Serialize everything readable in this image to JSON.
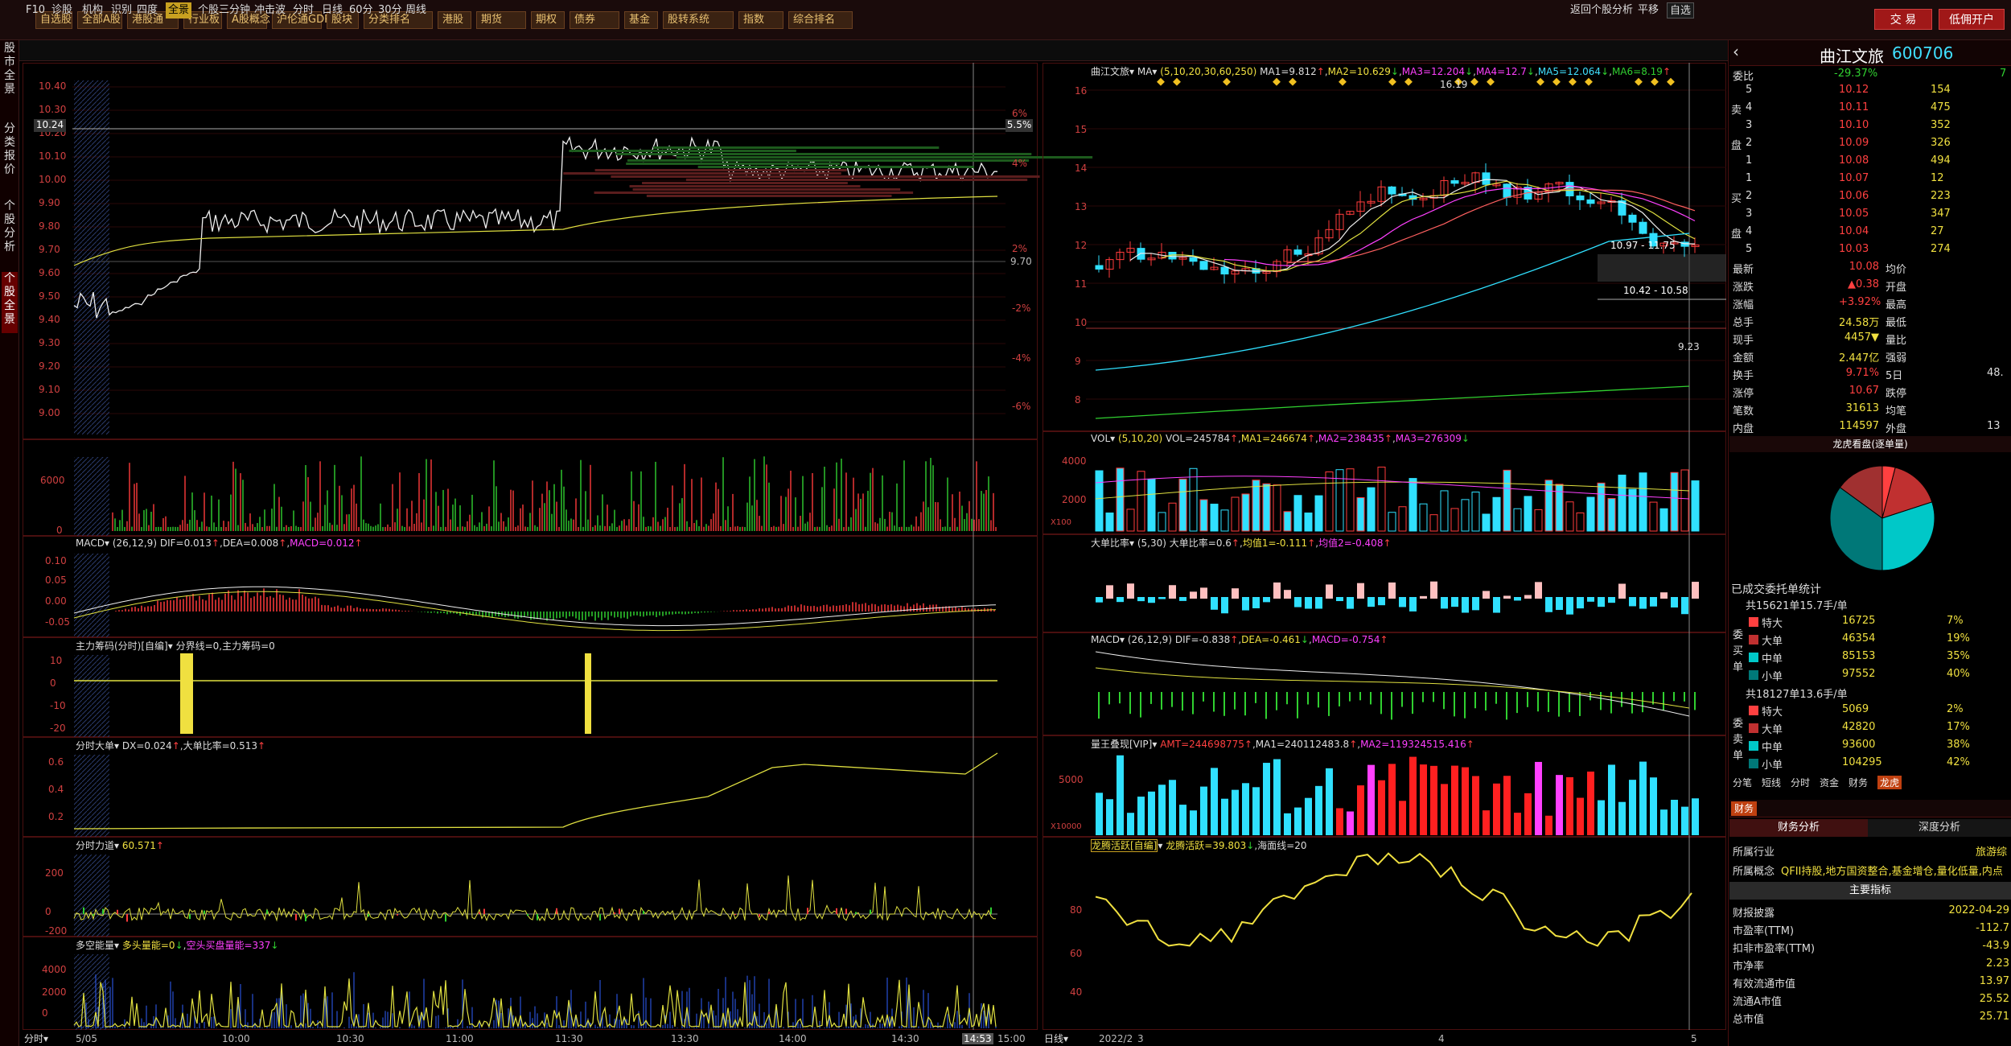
{
  "topbar": {
    "items": [
      "自选股",
      "全部A股",
      "港股通",
      "行业板",
      "A股概念",
      "沪伦通GDR",
      "股块",
      "分类排名",
      "港股",
      "期货",
      "期权",
      "债券",
      "基金",
      "股转系统",
      "指数",
      "综合排名"
    ],
    "trade": "交 易",
    "open_account": "低佣开户"
  },
  "tabs": {
    "items": [
      "F10",
      "诊股",
      "机构",
      "识别",
      "四度",
      "全景",
      "个股三分钟",
      "冲击波"
    ],
    "active": "全景",
    "chart_tabs": [
      "分时",
      "日线",
      "60分",
      "30分",
      "周线"
    ],
    "right_tabs": [
      "返回个股分析",
      "平移",
      "自选"
    ]
  },
  "rail": [
    "股市全景",
    "分类报价",
    "个股分析",
    "个股全景"
  ],
  "intraday": {
    "price_axis": [
      "10.40",
      "10.30",
      "10.20",
      "10.10",
      "10.00",
      "9.90",
      "9.80",
      "9.70",
      "9.60",
      "9.50",
      "9.40",
      "9.30",
      "9.20",
      "9.10",
      "9.00"
    ],
    "pct_axis": [
      "6%",
      "4%",
      "2%",
      "9.70",
      "-2%",
      "-4%",
      "-6%"
    ],
    "price_tag": "10.24",
    "pct_tag": "5.5%",
    "vol_axis": [
      "6000",
      "0"
    ],
    "macd": {
      "title": "MACD",
      "params": "(26,12,9)",
      "dif": "DIF=0.013",
      "dea": "DEA=0.008",
      "macd": "MACD=0.012",
      "axis": [
        "0.10",
        "0.05",
        "0.00",
        "-0.05"
      ]
    },
    "zhuli": {
      "title": "主力筹码(分时)[自编]",
      "line": "分界线=0,主力筹码=0",
      "axis": [
        "10",
        "0",
        "-10",
        "-20"
      ]
    },
    "dadan": {
      "title": "分时大单",
      "dx": "DX=0.024",
      "ratio": "大单比率=0.513",
      "axis": [
        "0.6",
        "0.4",
        "0.2"
      ]
    },
    "lidao": {
      "title": "分时力道",
      "val": "60.571",
      "axis": [
        "200",
        "0",
        "-200"
      ]
    },
    "duokong": {
      "title": "多空能量",
      "duo": "多头量能=0",
      "kong": "空头买盘量能=337",
      "axis": [
        "4000",
        "2000",
        "0"
      ]
    },
    "time_axis": [
      "5/05",
      "10:00",
      "10:30",
      "11:00",
      "11:30",
      "13:30",
      "14:00",
      "14:30",
      "14:53",
      "15:00"
    ],
    "bottom_label": "分时"
  },
  "daily": {
    "title": "曲江文旅",
    "ma_label": "MA",
    "ma_params": "(5,10,20,30,60,250)",
    "ma": [
      "MA1=9.812",
      "MA2=10.629",
      "MA3=12.204",
      "MA4=12.7",
      "MA5=12.064",
      "MA6=8.19"
    ],
    "price_axis": [
      "16",
      "15",
      "14",
      "13",
      "12",
      "11",
      "10",
      "9",
      "8"
    ],
    "high": "16.19",
    "low": "9.23",
    "box1": "10.97 - 11.75",
    "box2": "10.42 - 10.58",
    "vol": {
      "title": "VOL",
      "params": "(5,10,20)",
      "vals": [
        "VOL=245784",
        "MA1=246674",
        "MA2=238435",
        "MA3=276309"
      ],
      "axis": [
        "4000",
        "2000"
      ],
      "unit": "X100"
    },
    "dadan_ratio": {
      "title": "大单比率",
      "params": "(5,30)",
      "vals": [
        "大单比率=0.6",
        "均值1=-0.111",
        "均值2=-0.408"
      ]
    },
    "macd": {
      "title": "MACD",
      "params": "(26,12,9)",
      "vals": [
        "DIF=-0.838",
        "DEA=-0.461",
        "MACD=-0.754"
      ]
    },
    "liangwang": {
      "title": "量王叠现[VIP]",
      "vals": [
        "AMT=244698775",
        "MA1=240112483.8",
        "MA2=119324515.416"
      ],
      "axis": [
        "5000"
      ],
      "unit": "X10000"
    },
    "longteng": {
      "title": "龙腾活跃[自编]",
      "vals": [
        "龙腾活跃=39.803",
        "海面线=20"
      ],
      "axis": [
        "80",
        "60",
        "40"
      ]
    },
    "time_axis": [
      "2022/2",
      "3",
      "4",
      "5"
    ],
    "bottom_label": "日线"
  },
  "quote": {
    "name": "曲江文旅",
    "code": "600706",
    "weibi": {
      "label": "委比",
      "val": "-29.37%",
      "extra": "7"
    },
    "sells": [
      [
        "5",
        "10.12",
        "154"
      ],
      [
        "4",
        "10.11",
        "475"
      ],
      [
        "3",
        "10.10",
        "352"
      ],
      [
        "2",
        "10.09",
        "326"
      ],
      [
        "1",
        "10.08",
        "494"
      ]
    ],
    "buys": [
      [
        "1",
        "10.07",
        "12"
      ],
      [
        "2",
        "10.06",
        "223"
      ],
      [
        "3",
        "10.05",
        "347"
      ],
      [
        "4",
        "10.04",
        "27"
      ],
      [
        "5",
        "10.03",
        "274"
      ]
    ],
    "stats": [
      [
        "最新",
        "10.08",
        "均价",
        ""
      ],
      [
        "涨跌",
        "▲0.38",
        "开盘",
        ""
      ],
      [
        "涨幅",
        "+3.92%",
        "最高",
        ""
      ],
      [
        "总手",
        "24.58万",
        "最低",
        ""
      ],
      [
        "现手",
        "4457▼",
        "量比",
        ""
      ],
      [
        "金额",
        "2.447亿",
        "强弱",
        ""
      ],
      [
        "换手",
        "9.71%",
        "5日",
        "48."
      ],
      [
        "涨停",
        "10.67",
        "跌停",
        ""
      ],
      [
        "笔数",
        "31613",
        "均笔",
        ""
      ],
      [
        "内盘",
        "114597",
        "外盘",
        "13"
      ]
    ],
    "pie_title": "龙虎看盘(逐单量)",
    "order_title": "已成交委托单统计",
    "buy_total": "共15621单15.7手/单",
    "buy_rows": [
      [
        "特大",
        "16725",
        "7%"
      ],
      [
        "大单",
        "46354",
        "19%"
      ],
      [
        "中单",
        "85153",
        "35%"
      ],
      [
        "小单",
        "97552",
        "40%"
      ]
    ],
    "sell_total": "共18127单13.6手/单",
    "sell_rows": [
      [
        "特大",
        "5069",
        "2%"
      ],
      [
        "大单",
        "42820",
        "17%"
      ],
      [
        "中单",
        "93600",
        "38%"
      ],
      [
        "小单",
        "104295",
        "42%"
      ]
    ],
    "side_buy": [
      "委",
      "买",
      "单"
    ],
    "side_sell": [
      "委",
      "卖",
      "单"
    ],
    "bottom_tabs": [
      "分笔",
      "短线",
      "分时",
      "资金",
      "财务",
      "龙虎"
    ],
    "fin_tab": "财务",
    "fin_sub": [
      "财务分析",
      "深度分析"
    ],
    "industry": [
      "所属行业",
      "旅游综"
    ],
    "concept": [
      "所属概念",
      "QFII持股,地方国资整合,基金增仓,量化低量,内点"
    ],
    "main_idx": "主要指标",
    "fin_rows": [
      [
        "财报披露",
        "2022-04-29"
      ],
      [
        "市盈率(TTM)",
        "-112.7"
      ],
      [
        "扣非市盈率(TTM)",
        "-43.9"
      ],
      [
        "市净率",
        "2.23"
      ],
      [
        "有效流通市值",
        "13.97"
      ],
      [
        "流通A市值",
        "25.52"
      ],
      [
        "总市值",
        "25.71"
      ]
    ]
  },
  "colors": {
    "up": "#ff3b3b",
    "down": "#30e0ff",
    "grid": "#4a0f0f",
    "yellow": "#f0e040",
    "axis_red": "#d04040"
  }
}
